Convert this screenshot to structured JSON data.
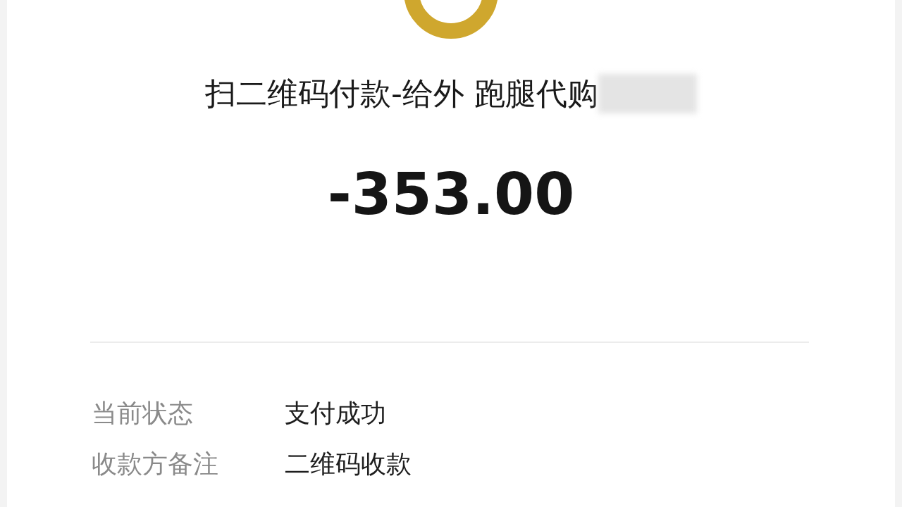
{
  "title": "扫二维码付款-给外 跑腿代购",
  "title_redacted": true,
  "amount": "-353.00",
  "details": [
    {
      "label": "当前状态",
      "value": "支付成功"
    },
    {
      "label": "收款方备注",
      "value": "二维码收款"
    }
  ]
}
